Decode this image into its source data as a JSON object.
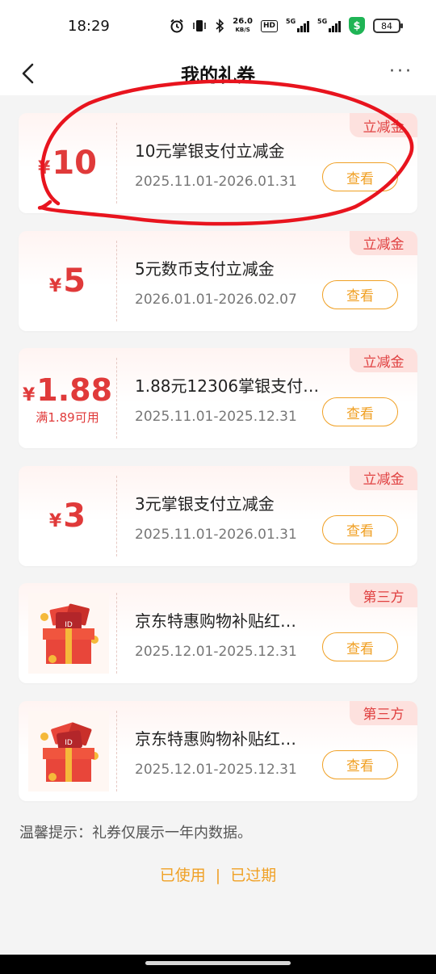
{
  "status_bar": {
    "time": "18:29",
    "net_speed_value": "26.0",
    "net_speed_unit": "KB/S",
    "hd": "HD",
    "sig1_label": "5G",
    "sig2_label": "5G",
    "battery": "84"
  },
  "header": {
    "title": "我的礼券",
    "more_label": "···"
  },
  "coupons": [
    {
      "tag": "立减金",
      "currency": "¥",
      "amount": "10",
      "condition": "",
      "title": "10元掌银支付立减金",
      "date_range": "2025.11.01-2026.01.31",
      "button": "查看"
    },
    {
      "tag": "立减金",
      "currency": "¥",
      "amount": "5",
      "condition": "",
      "title": "5元数币支付立减金",
      "date_range": "2026.01.01-2026.02.07",
      "button": "查看"
    },
    {
      "tag": "立减金",
      "currency": "¥",
      "amount": "1.88",
      "condition": "满1.89可用",
      "title": "1.88元12306掌银支付…",
      "date_range": "2025.11.01-2025.12.31",
      "button": "查看"
    },
    {
      "tag": "立减金",
      "currency": "¥",
      "amount": "3",
      "condition": "",
      "title": "3元掌银支付立减金",
      "date_range": "2025.11.01-2026.01.31",
      "button": "查看"
    },
    {
      "tag": "第三方",
      "image": "gift-box-image",
      "title": "京东特惠购物补贴红…",
      "date_range": "2025.12.01-2025.12.31",
      "button": "查看"
    },
    {
      "tag": "第三方",
      "image": "gift-box-image",
      "title": "京东特惠购物补贴红…",
      "date_range": "2025.12.01-2025.12.31",
      "button": "查看"
    }
  ],
  "footer": {
    "tip": "温馨提示：礼券仅展示一年内数据。",
    "used_link": "已使用",
    "separator": "|",
    "expired_link": "已过期"
  },
  "colors": {
    "accent_red": "#e03a3a",
    "accent_orange": "#f0a024",
    "annotation_red": "#e8141e"
  }
}
